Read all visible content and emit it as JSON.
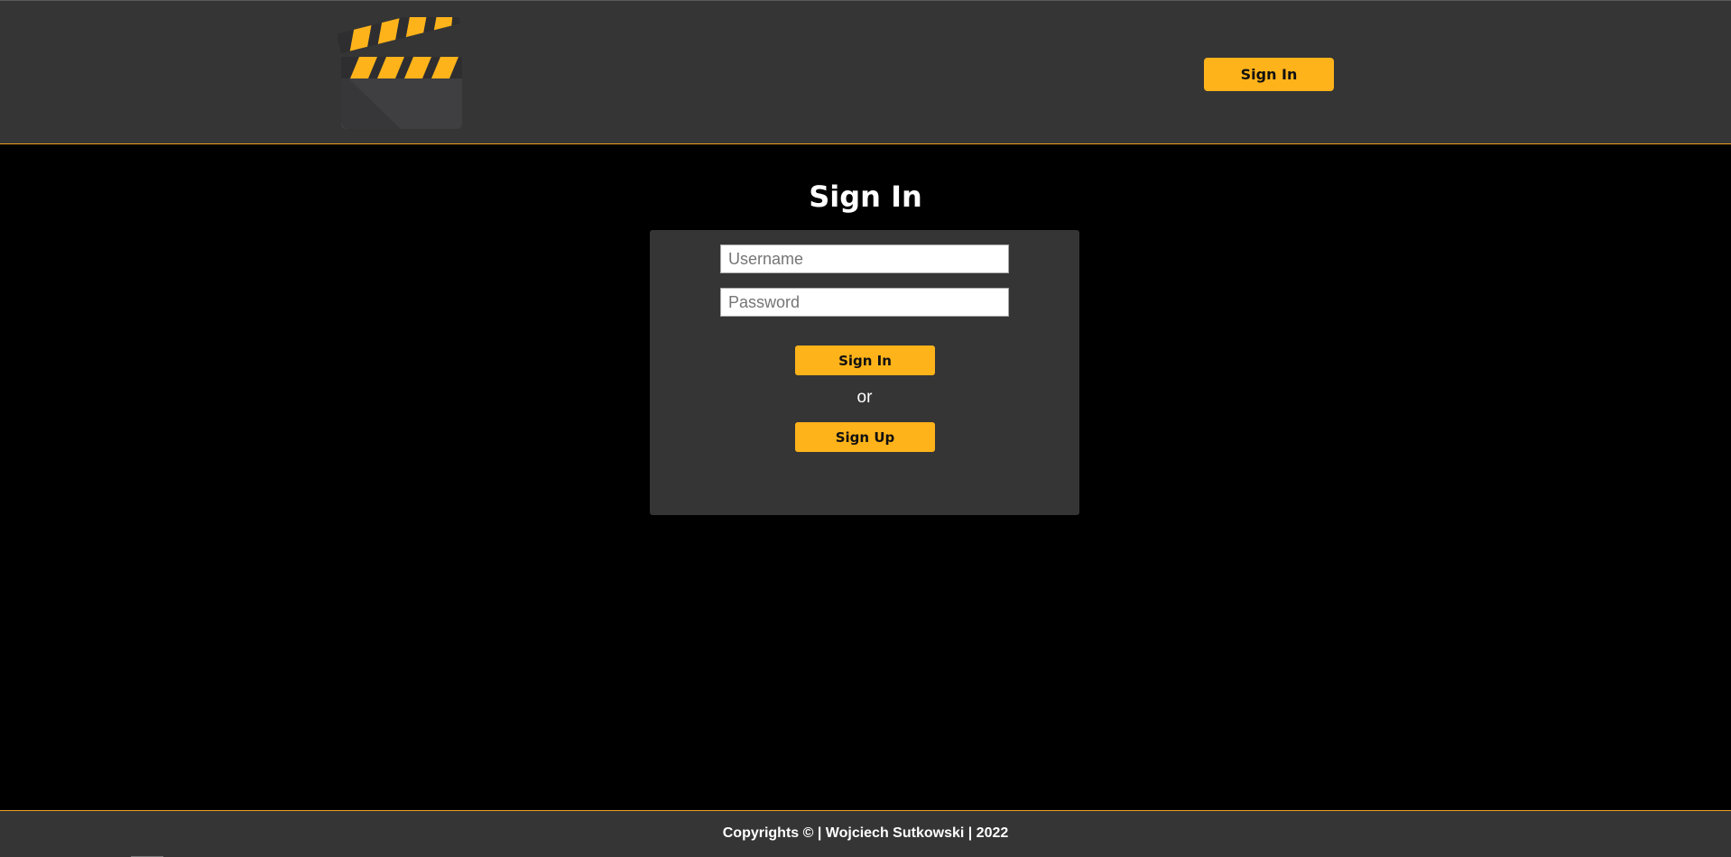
{
  "header": {
    "logo_icon": "clapperboard-icon",
    "signin_label": "Sign In"
  },
  "main": {
    "title": "Sign In",
    "username_placeholder": "Username",
    "password_placeholder": "Password",
    "signin_label": "Sign In",
    "or_text": "or",
    "signup_label": "Sign Up"
  },
  "footer": {
    "text": "Copyrights © | Wojciech Sutkowski | 2022"
  },
  "colors": {
    "accent": "#ffb31a",
    "panel": "#353535",
    "background": "#000000"
  }
}
